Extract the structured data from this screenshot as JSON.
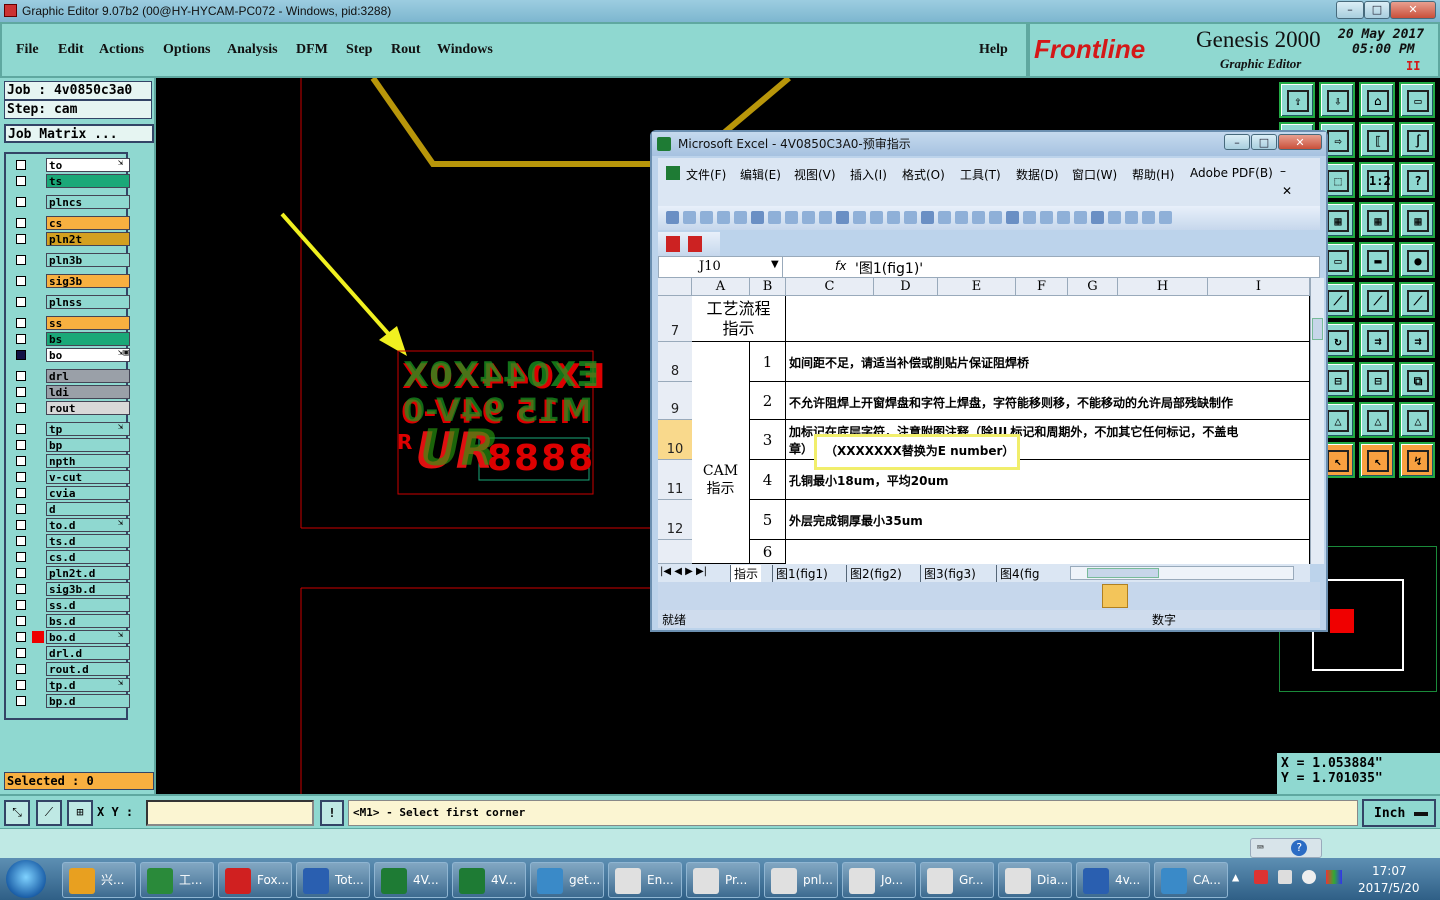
{
  "window": {
    "title": "Graphic Editor 9.07b2 (00@HY-HYCAM-PC072 - Windows, pid:3288)",
    "controls": [
      "–",
      "□",
      "✕"
    ]
  },
  "menu": {
    "file": "File",
    "edit": "Edit",
    "actions": "Actions",
    "options": "Options",
    "analysis": "Analysis",
    "dfm": "DFM",
    "step": "Step",
    "rout": "Rout",
    "windows": "Windows",
    "help": "Help"
  },
  "brand": {
    "logo": "Frontline",
    "product": "Genesis 2000",
    "subtitle": "Graphic Editor",
    "date": "20 May 2017",
    "time": "05:00 PM",
    "pause": "II"
  },
  "job": {
    "job_line": "Job : 4v0850c3a0",
    "step_line": "Step: cam",
    "matrix_button": "Job Matrix ..."
  },
  "layers": [
    {
      "name": "to",
      "color": "#ffffff",
      "flag": "⇲"
    },
    {
      "name": "ts",
      "color": "#1aa878",
      "flag": ""
    },
    {
      "name": "plncs",
      "color": "#8fd8d0",
      "flag": ""
    },
    {
      "name": "cs",
      "color": "#f8b040",
      "flag": ""
    },
    {
      "name": "pln2t",
      "color": "#d4a020",
      "flag": ""
    },
    {
      "name": "pln3b",
      "color": "#8fd8d0",
      "flag": ""
    },
    {
      "name": "sig3b",
      "color": "#f8b040",
      "flag": ""
    },
    {
      "name": "plnss",
      "color": "#8fd8d0",
      "flag": ""
    },
    {
      "name": "ss",
      "color": "#f8b040",
      "flag": ""
    },
    {
      "name": "bs",
      "color": "#1aa878",
      "flag": ""
    },
    {
      "name": "bo",
      "color": "#ffffff",
      "flag": "⇲▣"
    },
    {
      "name": "drl",
      "color": "#9aa0a8",
      "flag": ""
    },
    {
      "name": "ldi",
      "color": "#9aa0a8",
      "flag": ""
    },
    {
      "name": "rout",
      "color": "#d8d8d8",
      "flag": ""
    },
    {
      "name": "tp",
      "color": "#8fd8d0",
      "flag": "⇲"
    },
    {
      "name": "bp",
      "color": "#8fd8d0",
      "flag": ""
    },
    {
      "name": "npth",
      "color": "#8fd8d0",
      "flag": ""
    },
    {
      "name": "v-cut",
      "color": "#8fd8d0",
      "flag": ""
    },
    {
      "name": "cvia",
      "color": "#8fd8d0",
      "flag": ""
    },
    {
      "name": "d",
      "color": "#8fd8d0",
      "flag": ""
    },
    {
      "name": "to.d",
      "color": "#8fd8d0",
      "flag": "⇲"
    },
    {
      "name": "ts.d",
      "color": "#8fd8d0",
      "flag": ""
    },
    {
      "name": "cs.d",
      "color": "#8fd8d0",
      "flag": ""
    },
    {
      "name": "pln2t.d",
      "color": "#8fd8d0",
      "flag": ""
    },
    {
      "name": "sig3b.d",
      "color": "#8fd8d0",
      "flag": ""
    },
    {
      "name": "ss.d",
      "color": "#8fd8d0",
      "flag": ""
    },
    {
      "name": "bs.d",
      "color": "#8fd8d0",
      "flag": ""
    },
    {
      "name": "bo.d",
      "color": "#8fd8d0",
      "flag": "⇲"
    },
    {
      "name": "drl.d",
      "color": "#8fd8d0",
      "flag": ""
    },
    {
      "name": "rout.d",
      "color": "#8fd8d0",
      "flag": ""
    },
    {
      "name": "tp.d",
      "color": "#8fd8d0",
      "flag": "⇲"
    },
    {
      "name": "bp.d",
      "color": "#8fd8d0",
      "flag": ""
    }
  ],
  "selected": "Selected : 0",
  "coords": {
    "x": "X  = 1.053884\"",
    "y": "Y  = 1.701035\""
  },
  "cmd": {
    "xy_label": "X Y :",
    "xy_value": "",
    "warn": "!",
    "prompt": "<M1> - Select first corner",
    "units": "Inch"
  },
  "canvas_text": {
    "line1": "EX044X0X",
    "line2": "M15 94V-0",
    "line3": "8888",
    "ul": "UR",
    "reg": "R"
  },
  "excel": {
    "title": "Microsoft Excel - 4V0850C3A0-预审指示",
    "menus": [
      "文件(F)",
      "编辑(E)",
      "视图(V)",
      "插入(I)",
      "格式(O)",
      "工具(T)",
      "数据(D)",
      "窗口(W)",
      "帮助(H)",
      "Adobe PDF(B)"
    ],
    "name_box": "J10",
    "fx": "fx",
    "formula": "'图1(fig1)'",
    "columns": [
      "A",
      "B",
      "C",
      "D",
      "E",
      "F",
      "G",
      "H",
      "I"
    ],
    "rows": [
      {
        "num": "7",
        "a": "工艺流程\n指示",
        "b": "",
        "c": ""
      },
      {
        "num": "8",
        "a": "",
        "b": "1",
        "c": "如间距不足，请适当补偿或削贴片保证阻焊桥"
      },
      {
        "num": "9",
        "a": "",
        "b": "2",
        "c": "不允许阻焊上开窗焊盘和字符上焊盘，字符能移则移，不能移动的允许局部残缺制作"
      },
      {
        "num": "10",
        "a": "",
        "b": "3",
        "c": "加标记在底层字符，注意附图注释（除UL标记和周期外，不加其它任何标记，不盖电"
      },
      {
        "num": "11",
        "a": "",
        "b": "4",
        "c": "孔铜最小18um，平均20um"
      },
      {
        "num": "12",
        "a": "",
        "b": "5",
        "c": "外层完成铜厚最小35um"
      },
      {
        "num": "",
        "a": "",
        "b": "6",
        "c": ""
      }
    ],
    "row10_line2": "章）",
    "tooltip": "（XXXXXXX替换为E number）",
    "cam_label": "CAM\n指示",
    "sheets": [
      "指示",
      "图1(fig1)",
      "图2(fig2)",
      "图3(fig3)",
      "图4(fig"
    ],
    "status_ready": "就绪",
    "status_num": "数字",
    "pdf_label": "Adobe PDF"
  },
  "taskbar": {
    "items": [
      "兴...",
      "工...",
      "Fox...",
      "Tot...",
      "4V...",
      "4V...",
      "get...",
      "En...",
      "Pr...",
      "pnl...",
      "Jo...",
      "Gr...",
      "Dia...",
      "4v...",
      "CA..."
    ],
    "time": "17:07",
    "date": "2017/5/20"
  },
  "colors": {
    "panel": "#8fd8d0",
    "accent": "#f8a040",
    "excel": "#bcd3eb"
  }
}
